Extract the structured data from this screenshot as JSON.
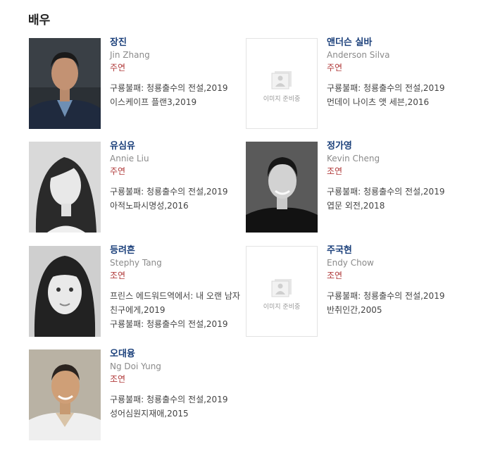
{
  "section": {
    "title": "배우"
  },
  "placeholder_text": "이미지 준비중",
  "actors": [
    {
      "name": "장진",
      "english": "Jin Zhang",
      "role": "주연",
      "works": [
        "구룡불패: 청룡출수의 전설,2019",
        "이스케이프 플랜3,2019"
      ],
      "photo": "portrait-photo"
    },
    {
      "name": "앤더슨 실바",
      "english": "Anderson Silva",
      "role": "주연",
      "works": [
        "구룡불패: 청룡출수의 전설,2019",
        "먼데이 나이츠 앳 세븐,2016"
      ],
      "photo": "placeholder"
    },
    {
      "name": "유심유",
      "english": "Annie Liu",
      "role": "주연",
      "works": [
        "구룡불패: 청룡출수의 전설,2019",
        "아적노파시명성,2016"
      ],
      "photo": "portrait-photo"
    },
    {
      "name": "정가영",
      "english": "Kevin Cheng",
      "role": "조연",
      "works": [
        "구룡불패: 청룡출수의 전설,2019",
        "엽문 외전,2018"
      ],
      "photo": "portrait-photo"
    },
    {
      "name": "등려흔",
      "english": "Stephy Tang",
      "role": "조연",
      "works": [
        "프린스 에드워드역에서: 내 오랜 남자친구에게,2019",
        "구룡불패: 청룡출수의 전설,2019"
      ],
      "photo": "portrait-photo"
    },
    {
      "name": "주국현",
      "english": "Endy Chow",
      "role": "조연",
      "works": [
        "구룡불패: 청룡출수의 전설,2019",
        "반취인간,2005"
      ],
      "photo": "placeholder"
    },
    {
      "name": "오대융",
      "english": "Ng Doi Yung",
      "role": "조연",
      "works": [
        "구룡불패: 청룡출수의 전설,2019",
        "성어심원지재애,2015"
      ],
      "photo": "portrait-photo"
    }
  ],
  "colors": {
    "name": "#1a3f7a",
    "role": "#b03a3a",
    "english": "#8a8a8a"
  }
}
